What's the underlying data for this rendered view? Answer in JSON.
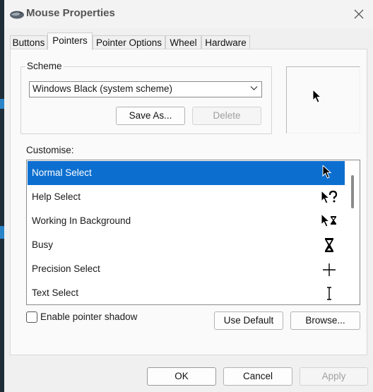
{
  "window": {
    "title": "Mouse Properties"
  },
  "tabs": [
    {
      "label": "Buttons"
    },
    {
      "label": "Pointers"
    },
    {
      "label": "Pointer Options"
    },
    {
      "label": "Wheel"
    },
    {
      "label": "Hardware"
    }
  ],
  "scheme": {
    "group_label": "Scheme",
    "selected": "Windows Black (system scheme)",
    "save_as_label": "Save As...",
    "delete_label": "Delete"
  },
  "customise": {
    "label": "Customise:",
    "items": [
      {
        "label": "Normal Select",
        "icon": "arrow-cursor-icon"
      },
      {
        "label": "Help Select",
        "icon": "help-cursor-icon"
      },
      {
        "label": "Working In Background",
        "icon": "working-cursor-icon"
      },
      {
        "label": "Busy",
        "icon": "busy-cursor-icon"
      },
      {
        "label": "Precision Select",
        "icon": "crosshair-cursor-icon"
      },
      {
        "label": "Text Select",
        "icon": "text-cursor-icon"
      }
    ]
  },
  "shadow": {
    "label": "Enable pointer shadow",
    "checked": false
  },
  "list_actions": {
    "use_default_label": "Use Default",
    "browse_label": "Browse..."
  },
  "footer": {
    "ok_label": "OK",
    "cancel_label": "Cancel",
    "apply_label": "Apply"
  },
  "colors": {
    "selection": "#0c6fd0",
    "panel": "#fafafa",
    "window": "#f0f0f0"
  }
}
